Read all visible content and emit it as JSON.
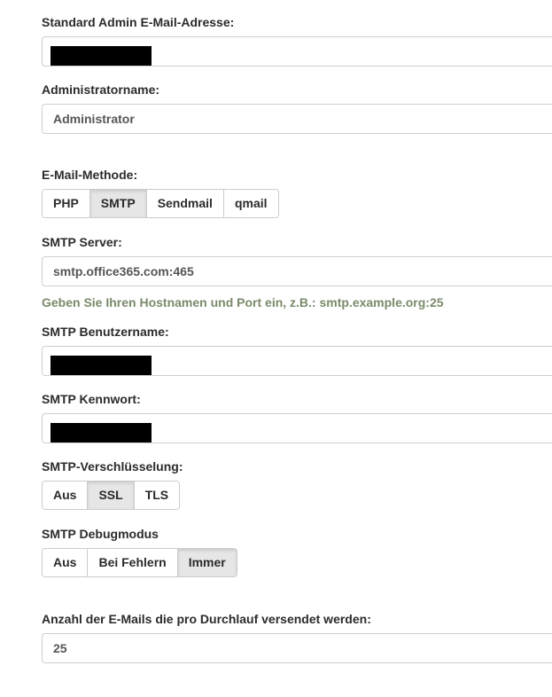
{
  "admin_email": {
    "label": "Standard Admin E-Mail-Adresse:",
    "value": ""
  },
  "admin_name": {
    "label": "Administratorname:",
    "value": "Administrator"
  },
  "mail_method": {
    "label": "E-Mail-Methode:",
    "options": [
      "PHP",
      "SMTP",
      "Sendmail",
      "qmail"
    ],
    "selected": "SMTP"
  },
  "smtp_server": {
    "label": "SMTP Server:",
    "value": "smtp.office365.com:465",
    "hint": "Geben Sie Ihren Hostnamen und Port ein, z.B.: smtp.example.org:25"
  },
  "smtp_username": {
    "label": "SMTP Benutzername:",
    "value": ""
  },
  "smtp_password": {
    "label": "SMTP Kennwort:",
    "value": ""
  },
  "smtp_encryption": {
    "label": "SMTP-Verschlüsselung:",
    "options": [
      "Aus",
      "SSL",
      "TLS"
    ],
    "selected": "SSL"
  },
  "smtp_debug": {
    "label": "SMTP Debugmodus",
    "options": [
      "Aus",
      "Bei Fehlern",
      "Immer"
    ],
    "selected": "Immer"
  },
  "mails_per_run": {
    "label": "Anzahl der E-Mails die pro Durchlauf versendet werden:",
    "value": "25"
  }
}
